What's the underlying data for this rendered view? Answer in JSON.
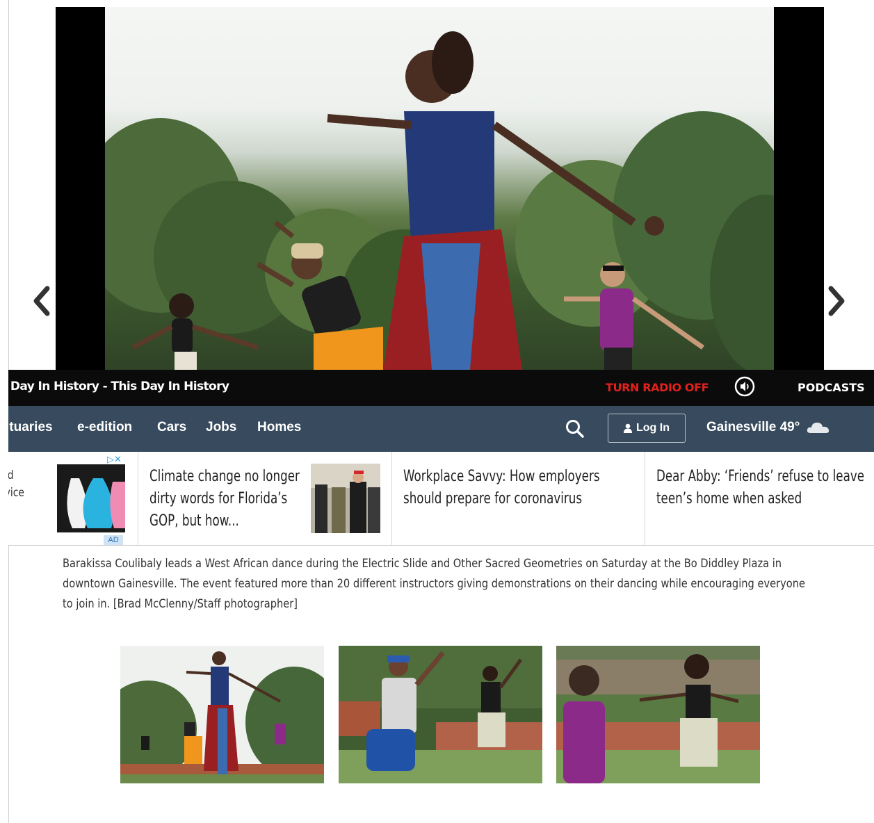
{
  "slideshow": {
    "photo_label": "Barakissa Coulibaly leads a West African dance",
    "prev_label": "previous-photo",
    "next_label": "next-photo"
  },
  "radio": {
    "ticker": "s Day In History - This Day In History",
    "turn_off_label": "TURN RADIO OFF",
    "podcasts_label": "PODCASTS"
  },
  "nav": {
    "links": [
      "ituaries",
      "e-edition",
      "Cars",
      "Jobs",
      "Homes"
    ],
    "login_label": "Log In",
    "weather": "Gainesville 49°"
  },
  "strip": {
    "ad_text_line1": "uld",
    "ad_text_line2": "evice",
    "ad_badge": "AD",
    "stories": [
      {
        "title": "Climate change no longer dirty words for Florida’s GOP, but how..."
      },
      {
        "title": "Workplace Savvy: How employers should prepare for coronavirus"
      },
      {
        "title": "Dear Abby: ‘Friends’ refuse to leave teen’s home when asked"
      }
    ]
  },
  "caption": "Barakissa Coulibaly leads a West African dance during the Electric Slide and Other Sacred Geometries on Saturday at the Bo Diddley Plaza in downtown Gainesville. The event featured more than 20 different instructors giving demonstrations on their dancing while encouraging everyone to join in. [Brad McClenny/Staff photographer]",
  "colors": {
    "nav_bg": "#384b5e",
    "radio_bg": "#0b0b0b",
    "radio_off": "#e0211c"
  }
}
